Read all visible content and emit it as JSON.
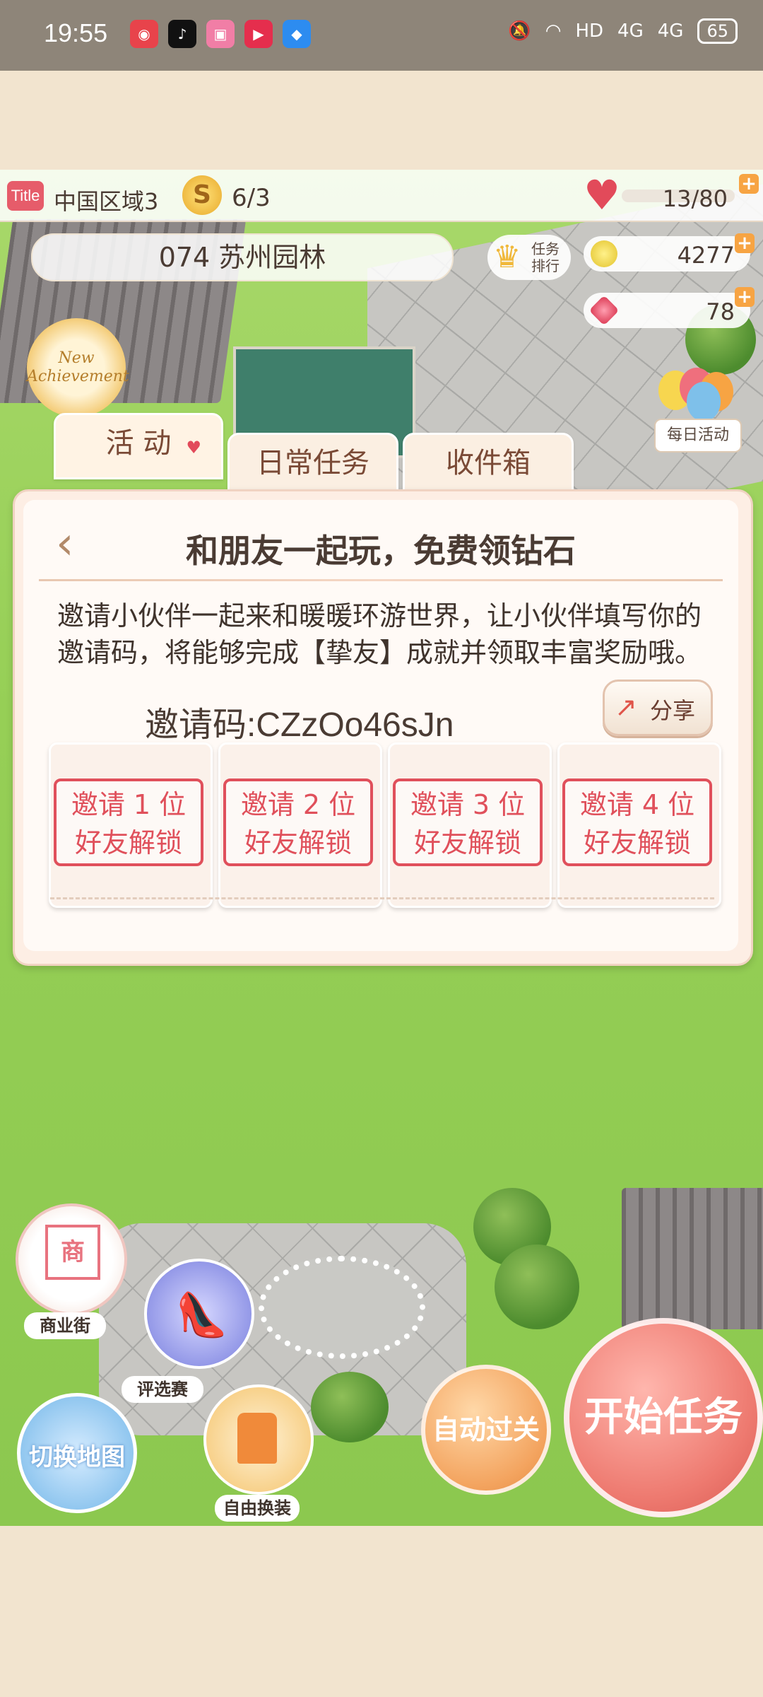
{
  "status_bar": {
    "time": "19:55",
    "app_icons": [
      "app-icon-1",
      "tiktok-icon",
      "bilibili-icon",
      "video-play-icon",
      "video-app-icon"
    ],
    "battery": "65",
    "network_1": "4G",
    "network_2": "4G",
    "hd": "HD"
  },
  "hud": {
    "title_badge": "Title",
    "region": "中国区域3",
    "stamina": "6/3",
    "hearts": "13/80",
    "level_name": "074 苏州园林",
    "rank_label": "任务排行",
    "coins": "4277",
    "gems": "78",
    "achievement": "New Achievement",
    "daily_activity": "每日活动"
  },
  "tabs": [
    {
      "label": "活 动"
    },
    {
      "label": "日常任务"
    },
    {
      "label": "收件箱"
    }
  ],
  "dialog": {
    "title": "和朋友一起玩，免费领钻石",
    "description": "邀请小伙伴一起来和暖暖环游世界，让小伙伴填写你的邀请码，将能够完成【挚友】成就并领取丰富奖励哦。",
    "invite_code": "邀请码:CZzOo46sJn",
    "share_label": "分享",
    "slots": [
      {
        "line1": "邀请 1 位",
        "line2": "好友解锁"
      },
      {
        "line1": "邀请 2 位",
        "line2": "好友解锁"
      },
      {
        "line1": "邀请 3 位",
        "line2": "好友解锁"
      },
      {
        "line1": "邀请 4 位",
        "line2": "好友解锁"
      }
    ]
  },
  "bottom": {
    "shop_sign": "商",
    "shop_label": "商业街",
    "contest_label": "评选赛",
    "map_label": "切换地图",
    "dressup_label": "自由换装",
    "auto_label": "自动过关",
    "start_label": "开始任务"
  },
  "colors": {
    "accent_red": "#e0505b",
    "grass": "#96cf56",
    "start_button": "#ee7a70",
    "auto_button": "#f3a35e"
  }
}
